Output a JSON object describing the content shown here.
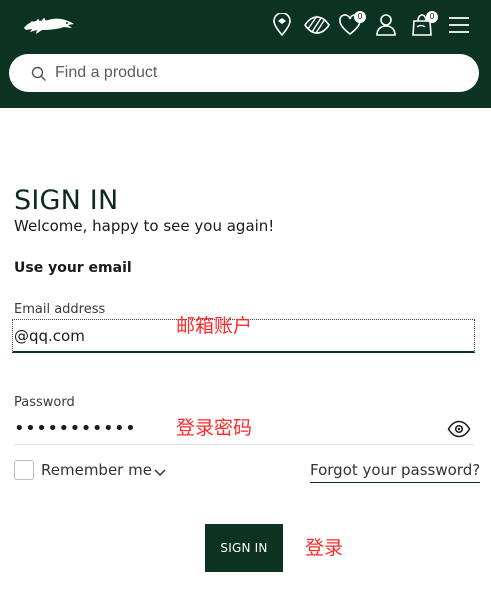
{
  "header": {
    "wishlist_count": "0",
    "cart_count": "0",
    "colors": {
      "brand_green": "#0c3322",
      "annotation_red": "#ff2a2a"
    },
    "icons": [
      "lacoste-crocodile-logo",
      "store-locator-icon",
      "visibility-off-icon",
      "wishlist-heart-icon",
      "account-icon",
      "cart-bag-icon",
      "menu-icon"
    ]
  },
  "search": {
    "placeholder": "Find a product",
    "value": ""
  },
  "form": {
    "title": "SIGN IN",
    "welcome": "Welcome, happy to see you again!",
    "subheading": "Use your email",
    "email_label": "Email address",
    "email_value": "@qq.com",
    "password_label": "Password",
    "password_value": "•••••••••••",
    "remember_label": "Remember me",
    "remember_checked": false,
    "forgot_label": "Forgot your password?",
    "submit_label": "SIGN IN"
  },
  "annotations": {
    "email": "邮箱账户",
    "password": "登录密码",
    "submit": "登录"
  }
}
